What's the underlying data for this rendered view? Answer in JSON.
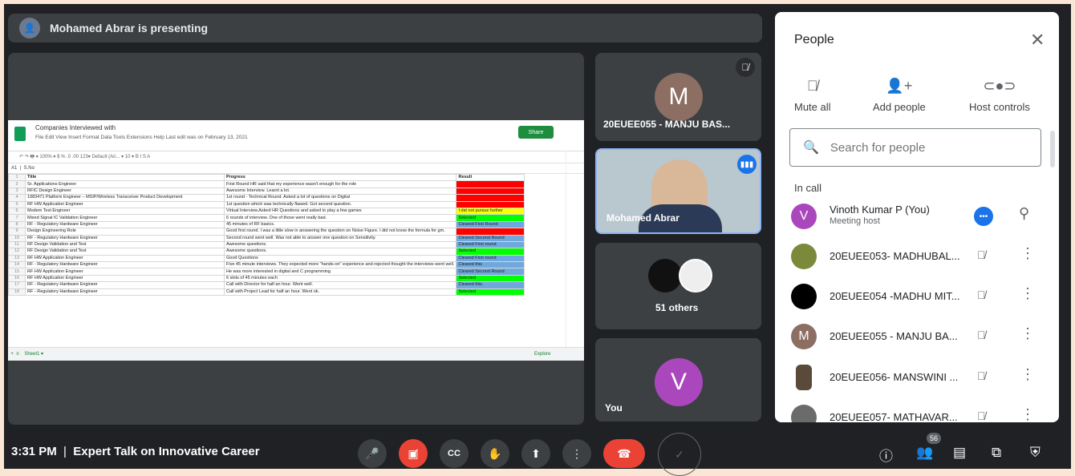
{
  "presentation": {
    "presenter_text": "Mohamed Abrar is presenting"
  },
  "sheet": {
    "title": "Companies Interviewed with",
    "menus": "File  Edit  View  Insert  Format  Data  Tools  Extensions  Help    Last edit was on February 13, 2021",
    "share_label": "Share",
    "toolbar_text": "↶ ↷ 🖶 ▾  100% ▾  $  %  .0  .00  123▾   Default (Ari... ▾   10  ▾   B  I  S  A",
    "formula_cell": "A1",
    "formula_value": "S.No",
    "tab_name": "Sheet1",
    "explore_label": "Explore",
    "header": [
      "Title",
      "Progress",
      "Result"
    ],
    "rows": [
      {
        "n": "1",
        "title": "Title",
        "progress": "Progress",
        "result": "Result",
        "color": "#ffffff"
      },
      {
        "n": "2",
        "title": "Sr. Applications Engineer",
        "progress": "First Round HR said that my experience wasn't enough for the role",
        "result": "",
        "color": "#ff0000"
      },
      {
        "n": "3",
        "title": "RFIC Design Engineer",
        "progress": "Awesome Interview. Learnt a lot.",
        "result": "",
        "color": "#ff0000"
      },
      {
        "n": "4",
        "title": "1983471 Platform Engineer – MSIP/Wireless Transceiver Product Development",
        "progress": "1st round - Technical Round. Asked a lot of questions on Digital",
        "result": "",
        "color": "#ff0000"
      },
      {
        "n": "5",
        "title": "RF HW Application Engineer",
        "progress": "1st question which was technically flawed. Got second question.",
        "result": "",
        "color": "#ff0000"
      },
      {
        "n": "6",
        "title": "Modem Test Engineer",
        "progress": "Virtual Interview.Asked HR Questions and asked to play a few games",
        "result": "I did not pursue further",
        "color": "#ffff00"
      },
      {
        "n": "7",
        "title": "Mixed Signal IC Validation Engineer",
        "progress": "6 rounds of interview. One of those went really bad.",
        "result": "Selected",
        "color": "#00ff00"
      },
      {
        "n": "8",
        "title": "RF - Regulatory Hardware Engineer",
        "progress": "45 minutes of RF basics.",
        "result": "Cleared First Round",
        "color": "#6fa8dc"
      },
      {
        "n": "9",
        "title": "Design Engineering Role",
        "progress": "Good first round. I was a little slow in answering the question on Noise Figure. I did not know the formula for gm.",
        "result": "",
        "color": "#ff0000"
      },
      {
        "n": "10",
        "title": "RF - Regulatory Hardware Engineer",
        "progress": "Second round went well. Was not able to answer one question on Sensitivity.",
        "result": "Cleared Second Round",
        "color": "#6fa8dc"
      },
      {
        "n": "11",
        "title": "RF Design Validation and Test",
        "progress": "Awesome questions.",
        "result": "Cleared First round",
        "color": "#6fa8dc"
      },
      {
        "n": "12",
        "title": "RF Design Validation and Test",
        "progress": "Awesome questions.",
        "result": "Selected",
        "color": "#00ff00"
      },
      {
        "n": "13",
        "title": "RF HW Application Engineer",
        "progress": "Good Questions",
        "result": "Cleared First round",
        "color": "#6fa8dc"
      },
      {
        "n": "14",
        "title": "RF - Regulatory Hardware Engineer",
        "progress": "Five 45 minute interviews. They expected more \"hands-on\" experience and rejected thought the interviews went well.",
        "result": "Cleared this",
        "color": "#6fa8dc"
      },
      {
        "n": "15",
        "title": "RF HW Application Engineer",
        "progress": "He was more interested in digital and C programming",
        "result": "Cleared Second Round",
        "color": "#6fa8dc"
      },
      {
        "n": "16",
        "title": "RF HW Application Engineer",
        "progress": "6 slots of 45 minutes each",
        "result": "Selected",
        "color": "#00ff00"
      },
      {
        "n": "17",
        "title": "RF - Regulatory Hardware Engineer",
        "progress": "Call with Director for half an hour. Went well.",
        "result": "Cleared this.",
        "color": "#6fa8dc"
      },
      {
        "n": "18",
        "title": "RF - Regulatory Hardware Engineer",
        "progress": "Call with Project Lead for half an hour. Went ok.",
        "result": "Selected",
        "color": "#00ff00"
      }
    ]
  },
  "tiles": {
    "manju": {
      "initial": "M",
      "name": "20EUEE055 - MANJU BAS...",
      "color": "#8d6e63"
    },
    "abrar": {
      "name": "Mohamed Abrar"
    },
    "others": {
      "label": "51 others"
    },
    "you": {
      "initial": "V",
      "name": "You",
      "color": "#ab47bc"
    }
  },
  "people_panel": {
    "title": "People",
    "actions": [
      {
        "label": "Mute all",
        "icon": "mic-off-icon"
      },
      {
        "label": "Add people",
        "icon": "add-person-icon"
      },
      {
        "label": "Host controls",
        "icon": "toggle-icon"
      }
    ],
    "search_placeholder": "Search for people",
    "section_label": "In call",
    "participants": [
      {
        "name": "Vinoth Kumar P (You)",
        "sub": "Meeting host",
        "initial": "V",
        "color": "#ab47bc"
      },
      {
        "name": "20EUEE053- MADHUBAL...",
        "initial": "",
        "color": "#7a8a3a"
      },
      {
        "name": "20EUEE054 -MADHU MIT...",
        "initial": "",
        "color": "#000000"
      },
      {
        "name": "20EUEE055 - MANJU BA...",
        "initial": "M",
        "color": "#8d6e63"
      },
      {
        "name": "20EUEE056- MANSWINI ...",
        "initial": "",
        "color": "#5a4a3a"
      },
      {
        "name": "20EUEE057- MATHAVAR...",
        "initial": "",
        "color": "#6b6b6b"
      }
    ]
  },
  "bottom_bar": {
    "time": "3:31 PM",
    "separator": "|",
    "meeting_title": "Expert Talk on Innovative Career",
    "participant_count": "56"
  }
}
